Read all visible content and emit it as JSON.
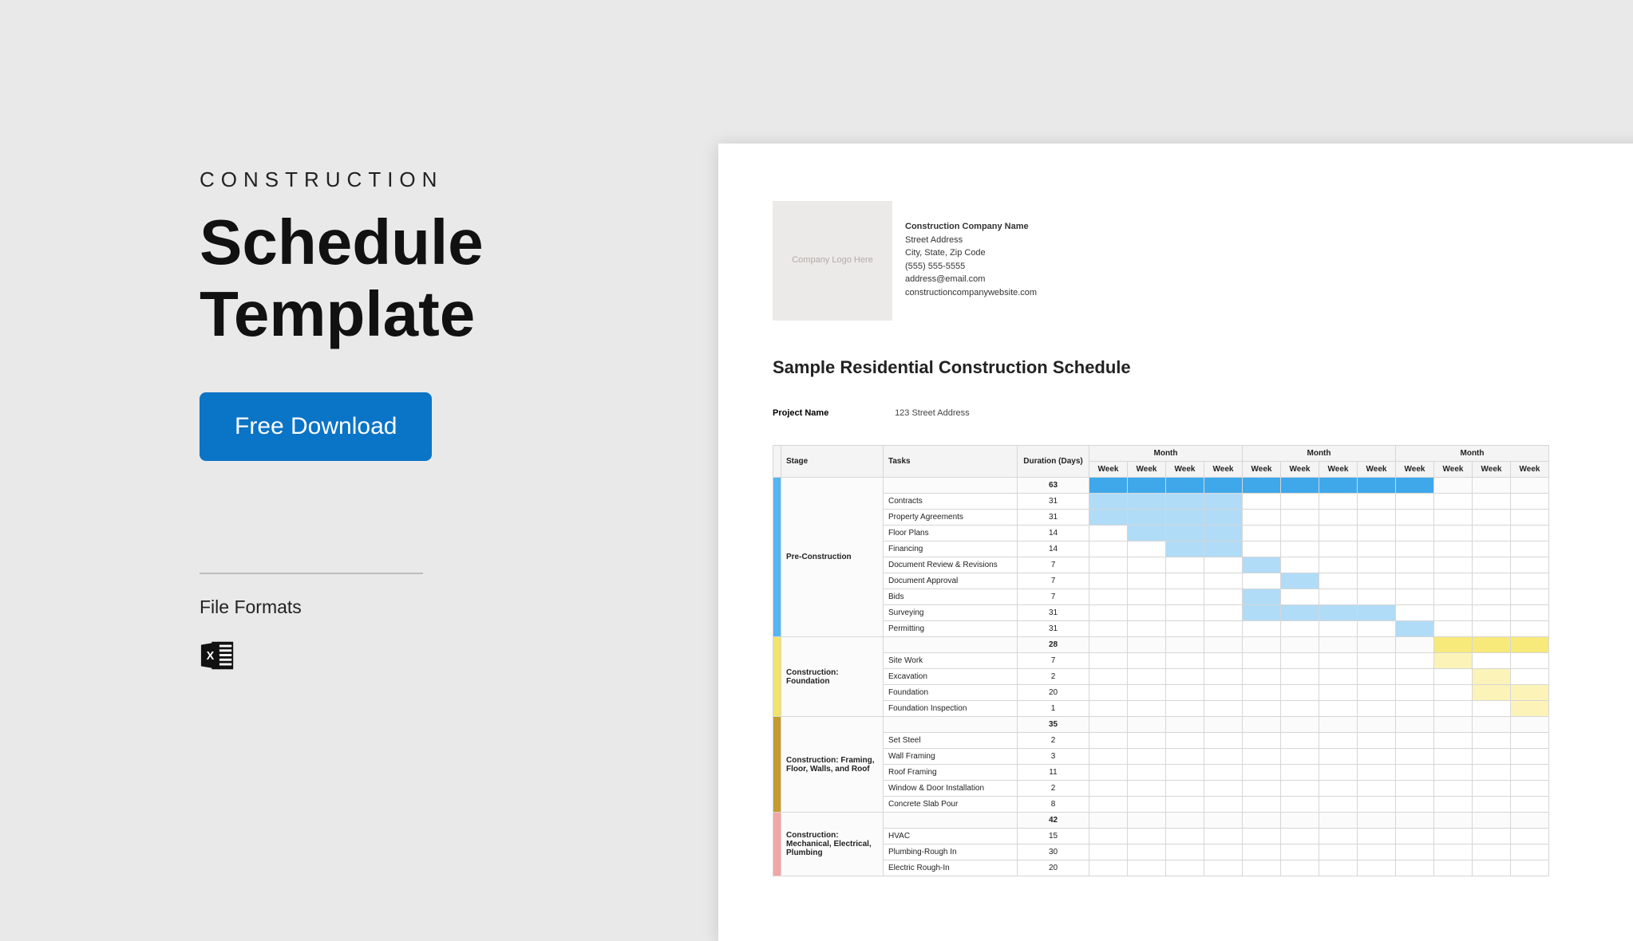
{
  "eyebrow": "CONSTRUCTION",
  "title_line1": "Schedule",
  "title_line2": "Template",
  "download_label": "Free Download",
  "file_formats_label": "File Formats",
  "preview": {
    "logo_placeholder": "Company Logo Here",
    "company": {
      "name": "Construction Company Name",
      "street": "Street Address",
      "csz": "City, State, Zip Code",
      "phone": "(555) 555-5555",
      "email": "address@email.com",
      "web": "constructioncompanywebsite.com"
    },
    "doc_title": "Sample Residential Construction Schedule",
    "project_label": "Project Name",
    "project_value": "123 Street Address",
    "headers": {
      "stage": "Stage",
      "tasks": "Tasks",
      "duration": "Duration (Days)",
      "month": "Month",
      "week": "Week"
    },
    "stages": [
      {
        "color": "blue",
        "name": "Pre-Construction",
        "total": 63,
        "stage_bar": {
          "start": 0,
          "end": 8,
          "class": "g-blue"
        },
        "tasks": [
          {
            "name": "Contracts",
            "dur": 31,
            "bar": {
              "start": 0,
              "end": 3,
              "class": "g-lblue"
            }
          },
          {
            "name": "Property Agreements",
            "dur": 31,
            "bar": {
              "start": 0,
              "end": 3,
              "class": "g-lblue"
            }
          },
          {
            "name": "Floor Plans",
            "dur": 14,
            "bar": {
              "start": 1,
              "end": 3,
              "class": "g-lblue"
            }
          },
          {
            "name": "Financing",
            "dur": 14,
            "bar": {
              "start": 2,
              "end": 3,
              "class": "g-lblue"
            }
          },
          {
            "name": "Document Review & Revisions",
            "dur": 7,
            "bar": {
              "start": 4,
              "end": 4,
              "class": "g-lblue"
            }
          },
          {
            "name": "Document Approval",
            "dur": 7,
            "bar": {
              "start": 5,
              "end": 5,
              "class": "g-lblue"
            }
          },
          {
            "name": "Bids",
            "dur": 7,
            "bar": {
              "start": 4,
              "end": 4,
              "class": "g-lblue"
            }
          },
          {
            "name": "Surveying",
            "dur": 31,
            "bar": {
              "start": 4,
              "end": 7,
              "class": "g-lblue"
            }
          },
          {
            "name": "Permitting",
            "dur": 31,
            "bar": {
              "start": 8,
              "end": 8,
              "class": "g-lblue"
            }
          }
        ]
      },
      {
        "color": "yellow",
        "name": "Construction: Foundation",
        "total": 28,
        "stage_bar": {
          "start": 9,
          "end": 11,
          "class": "g-yellow"
        },
        "tasks": [
          {
            "name": "Site Work",
            "dur": 7,
            "bar": {
              "start": 9,
              "end": 9,
              "class": "g-lyel"
            }
          },
          {
            "name": "Excavation",
            "dur": 2,
            "bar": {
              "start": 10,
              "end": 10,
              "class": "g-lyel"
            }
          },
          {
            "name": "Foundation",
            "dur": 20,
            "bar": {
              "start": 10,
              "end": 11,
              "class": "g-lyel"
            }
          },
          {
            "name": "Foundation Inspection",
            "dur": 1,
            "bar": {
              "start": 11,
              "end": 11,
              "class": "g-lyel"
            }
          }
        ]
      },
      {
        "color": "gold",
        "name": "Construction: Framing, Floor, Walls, and Roof",
        "total": 35,
        "tasks": [
          {
            "name": "Set Steel",
            "dur": 2
          },
          {
            "name": "Wall Framing",
            "dur": 3
          },
          {
            "name": "Roof Framing",
            "dur": 11
          },
          {
            "name": "Window & Door Installation",
            "dur": 2
          },
          {
            "name": "Concrete Slab Pour",
            "dur": 8
          }
        ]
      },
      {
        "color": "pink",
        "name": "Construction: Mechanical, Electrical, Plumbing",
        "total": 42,
        "tasks": [
          {
            "name": "HVAC",
            "dur": 15
          },
          {
            "name": "Plumbing-Rough In",
            "dur": 30
          },
          {
            "name": "Electric Rough-In",
            "dur": 20
          }
        ]
      }
    ],
    "week_count": 12
  }
}
